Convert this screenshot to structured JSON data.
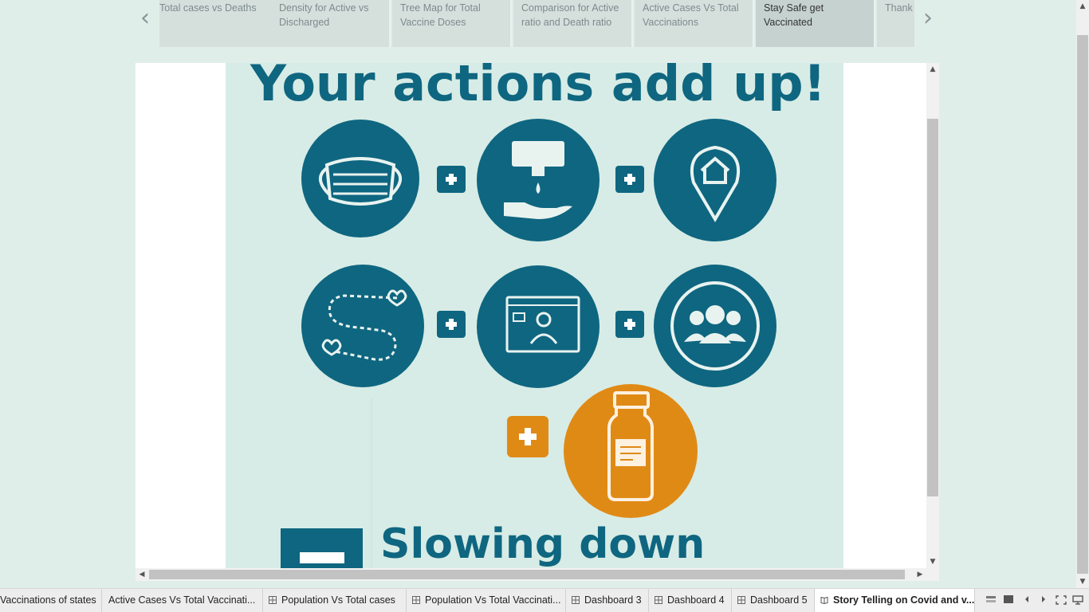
{
  "story_points": [
    {
      "label": "Total cases vs Deaths"
    },
    {
      "label": "Density for Active vs Discharged"
    },
    {
      "label": "Tree Map for Total Vaccine Doses"
    },
    {
      "label": "Comparison for Active ratio and Death ratio"
    },
    {
      "label": "Active Cases Vs Total Vaccinations"
    },
    {
      "label": "Stay Safe get Vaccinated",
      "active": true
    },
    {
      "label": "Thank"
    }
  ],
  "nav": {
    "prev_glyph": "‹",
    "next_glyph": "›"
  },
  "poster": {
    "headline": "Your actions add up!",
    "footer_text": "Slowing down",
    "plus_symbol": "+",
    "icons": [
      "face-mask-icon",
      "hand-sanitizer-icon",
      "stay-home-icon",
      "social-distance-icon",
      "video-call-icon",
      "group-icon",
      "vaccine-vial-icon",
      "minus-icon"
    ],
    "colors": {
      "teal": "#0f6680",
      "orange": "#e08a16",
      "background": "#d7ece6"
    }
  },
  "scroll": {
    "up": "▲",
    "down": "▼",
    "left": "◀",
    "right": "▶"
  },
  "sheet_tabs": [
    {
      "label": "Vaccinations of states",
      "type": "sheet"
    },
    {
      "label": "Active Cases Vs Total Vaccinati...",
      "type": "sheet"
    },
    {
      "label": "Population Vs Total cases",
      "type": "dashboard"
    },
    {
      "label": "Population Vs Total Vaccinati...",
      "type": "dashboard"
    },
    {
      "label": "Dashboard 3",
      "type": "dashboard"
    },
    {
      "label": "Dashboard 4",
      "type": "dashboard"
    },
    {
      "label": "Dashboard 5",
      "type": "dashboard"
    },
    {
      "label": "Story Telling on Covid and v...",
      "type": "story",
      "active": true
    }
  ]
}
